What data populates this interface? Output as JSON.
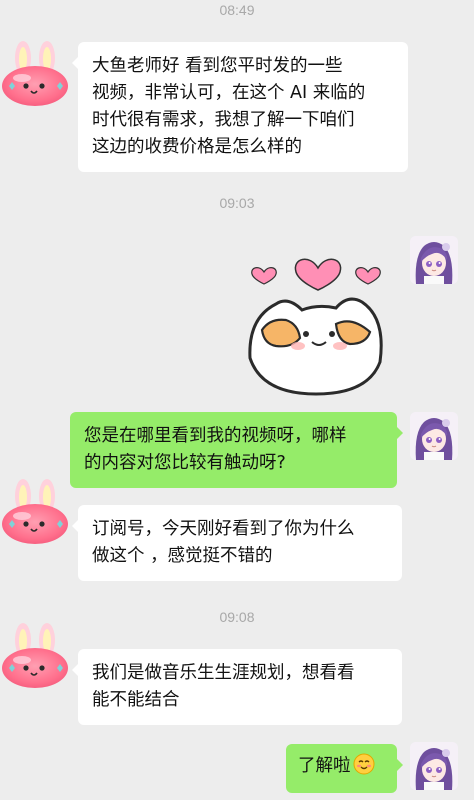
{
  "timestamps": [
    "08:49",
    "09:03",
    "09:08"
  ],
  "messages": [
    {
      "from": "contact",
      "text": "大鱼老师好 看到您平时发的一些视频，非常认可，在这个AI来临的时代很有需求，我想了解一下咱们这边的收费价格是怎么样的"
    },
    {
      "from": "me",
      "type": "sticker",
      "sticker": "cat-hearts"
    },
    {
      "from": "me",
      "text": "您是在哪里看到我的视频呀，哪样的内容对您比较有触动呀?"
    },
    {
      "from": "contact",
      "text": "订阅号，今天刚好看到了你为什么做这个 ，感觉挺不错的"
    },
    {
      "from": "contact",
      "text": "我们是做音乐生生涯规划，想看看能不能结合"
    },
    {
      "from": "me",
      "text": "了解啦",
      "emoji": "blush-smile"
    }
  ],
  "lines": {
    "m1": [
      "大鱼老师好 看到您平时发的一些",
      "视频，非常认可，在这个 AI 来临的",
      "时代很有需求，我想了解一下咱们",
      "这边的收费价格是怎么样的"
    ],
    "m3": [
      "您是在哪里看到我的视频呀，哪样",
      "的内容对您比较有触动呀?"
    ],
    "m4": [
      "订阅号，今天刚好看到了你为什么",
      "做这个 ，感觉挺不错的"
    ],
    "m5": [
      "我们是做音乐生生涯规划，想看看",
      "能不能结合"
    ],
    "m6": "了解啦"
  },
  "colors": {
    "my_bubble": "#95ec69",
    "their_bubble": "#ffffff",
    "background": "#ededed"
  },
  "avatars": {
    "contact": "pink-bunny-avatar",
    "me": "purple-hair-anime-girl-avatar"
  }
}
